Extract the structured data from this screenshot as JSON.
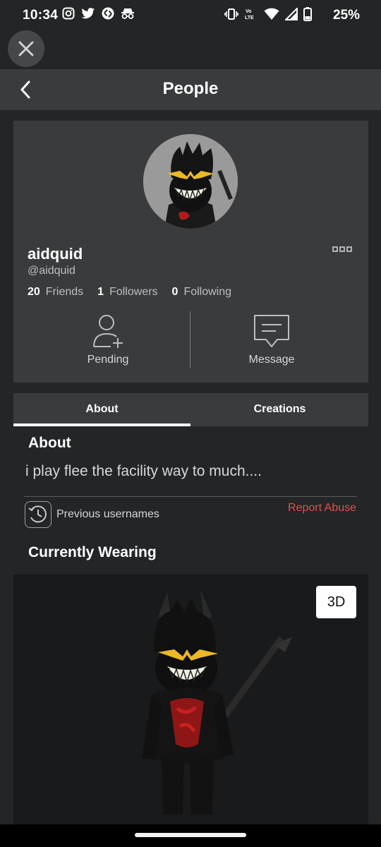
{
  "status_bar": {
    "time": "10:34",
    "battery_percent": "25%",
    "left_icons": [
      "instagram-icon",
      "twitter-icon",
      "shazam-icon",
      "incognito-icon"
    ],
    "right_icons": [
      "vibrate-icon",
      "volte-icon",
      "wifi-icon",
      "signal-icon",
      "battery-icon"
    ],
    "volte_label": "Vo LTE"
  },
  "header": {
    "title": "People"
  },
  "profile": {
    "display_name": "aidquid",
    "username": "@aidquid",
    "stats": [
      {
        "count": "20",
        "label": "Friends"
      },
      {
        "count": "1",
        "label": "Followers"
      },
      {
        "count": "0",
        "label": "Following"
      }
    ],
    "actions": {
      "pending": "Pending",
      "message": "Message"
    }
  },
  "tabs": [
    {
      "label": "About",
      "active": true
    },
    {
      "label": "Creations",
      "active": false
    }
  ],
  "about": {
    "heading": "About",
    "text": "i play flee the facility way to much....",
    "previous_usernames": "Previous usernames",
    "report_abuse": "Report Abuse"
  },
  "wearing": {
    "heading": "Currently Wearing",
    "view_3d": "3D"
  },
  "colors": {
    "background": "#232527",
    "card": "#393b3d",
    "accent_red": "#e2524a"
  }
}
